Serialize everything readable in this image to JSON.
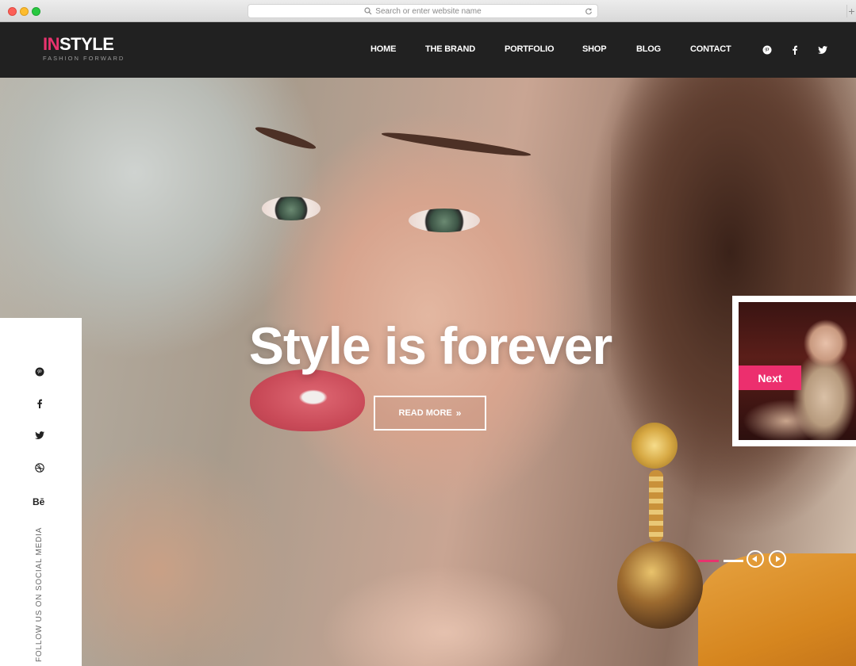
{
  "browser": {
    "url_placeholder": "Search or enter website name"
  },
  "brand": {
    "logo_accent": "IN",
    "logo_rest": "STYLE",
    "tagline": "FASHION FORWARD",
    "accent_color": "#e8336e"
  },
  "nav": {
    "items": [
      {
        "label": "HOME"
      },
      {
        "label": "THE BRAND"
      },
      {
        "label": "PORTFOLIO"
      },
      {
        "label": "SHOP"
      },
      {
        "label": "BLOG"
      },
      {
        "label": "CONTACT"
      }
    ],
    "social_icons": [
      "pinterest-icon",
      "facebook-icon",
      "twitter-icon"
    ]
  },
  "hero": {
    "headline": "Style is forever",
    "cta_label": "READ MORE",
    "cta_icon": "double-chevron-right-icon"
  },
  "social_sidebar": {
    "icons": [
      "pinterest-icon",
      "facebook-icon",
      "twitter-icon",
      "dribbble-icon"
    ],
    "behance_label": "Bē",
    "follow_text": "FOLLOW US ON SOCIAL MEDIA"
  },
  "next_preview": {
    "label": "Next"
  },
  "slider": {
    "total_slides": 2,
    "active_slide": 1,
    "prev_icon": "play-left-icon",
    "next_icon": "play-right-icon"
  }
}
